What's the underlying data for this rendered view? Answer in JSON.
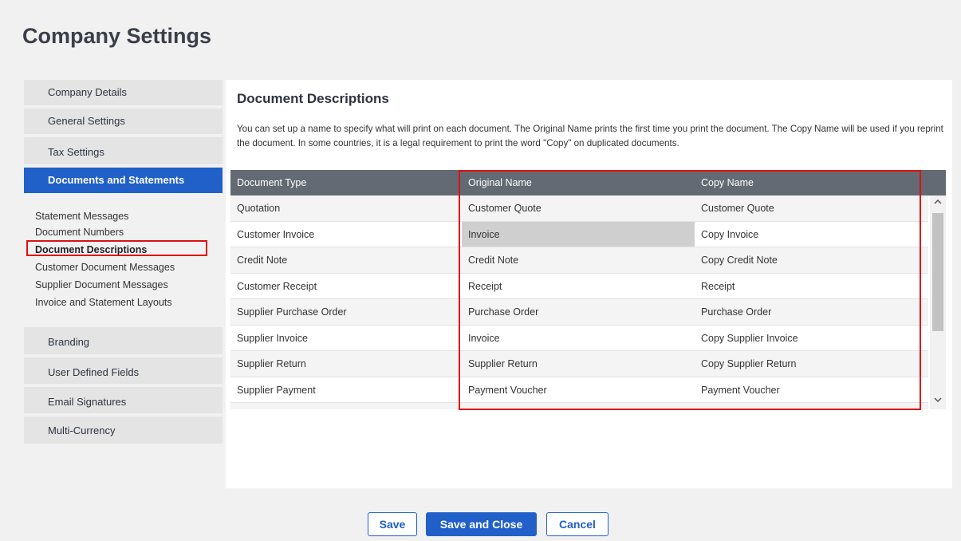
{
  "page": {
    "title": "Company Settings"
  },
  "sidebar": {
    "top_items": [
      {
        "label": "Company Details"
      },
      {
        "label": "General Settings"
      },
      {
        "label": "Tax Settings"
      },
      {
        "label": "Documents and Statements",
        "active": true
      }
    ],
    "sub_items": [
      {
        "label": "Statement Messages"
      },
      {
        "label": "Document Numbers"
      },
      {
        "label": "Document Descriptions",
        "current": true
      },
      {
        "label": "Customer Document Messages"
      },
      {
        "label": "Supplier Document Messages"
      },
      {
        "label": "Invoice and Statement Layouts"
      }
    ],
    "bottom_items": [
      {
        "label": "Branding"
      },
      {
        "label": "User Defined Fields"
      },
      {
        "label": "Email Signatures"
      },
      {
        "label": "Multi-Currency"
      }
    ]
  },
  "panel": {
    "title": "Document Descriptions",
    "description": "You can set up a name to specify what will print on each document. The Original Name prints the first time you print the document. The Copy Name will be used if you reprint the document. In some countries, it is a legal requirement to print the word \"Copy\" on duplicated documents."
  },
  "table": {
    "columns": [
      "Document Type",
      "Original Name",
      "Copy Name"
    ],
    "rows": [
      [
        "Quotation",
        "Customer Quote",
        "Customer Quote"
      ],
      [
        "Customer Invoice",
        "Invoice",
        "Copy Invoice"
      ],
      [
        "Credit Note",
        "Credit Note",
        "Copy Credit Note"
      ],
      [
        "Customer Receipt",
        "Receipt",
        "Receipt"
      ],
      [
        "Supplier Purchase Order",
        "Purchase Order",
        "Purchase Order"
      ],
      [
        "Supplier Invoice",
        "Invoice",
        "Copy Supplier Invoice"
      ],
      [
        "Supplier Return",
        "Supplier Return",
        "Copy Supplier Return"
      ],
      [
        "Supplier Payment",
        "Payment Voucher",
        "Payment Voucher"
      ]
    ],
    "selected_row": 1,
    "selected_col": 1
  },
  "icons": {
    "scroll_up": "chevron-up-icon",
    "scroll_down": "chevron-down-icon"
  },
  "footer": {
    "save_label": "Save",
    "save_close_label": "Save and Close",
    "cancel_label": "Cancel"
  },
  "colors": {
    "accent": "#2060c8",
    "highlight": "#e01010",
    "header_bg": "#636a74"
  }
}
